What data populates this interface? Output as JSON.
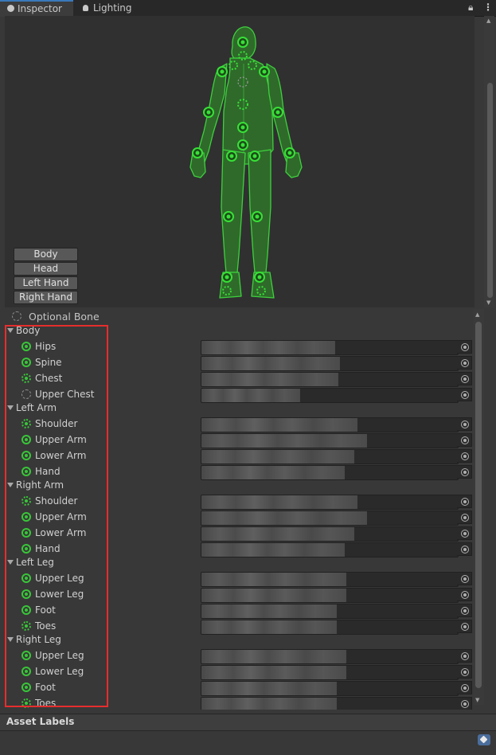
{
  "tabs": [
    {
      "label": "Inspector",
      "icon": "info-icon",
      "active": true
    },
    {
      "label": "Lighting",
      "icon": "bulb-icon",
      "active": false
    }
  ],
  "tab_controls": {
    "lock_icon": "lock-icon",
    "menu_icon": "kebab-menu-icon"
  },
  "avatar_buttons": [
    "Body",
    "Head",
    "Left Hand",
    "Right Hand"
  ],
  "optional_bone_label": "Optional Bone",
  "groups": [
    {
      "label": "Body",
      "bones": [
        {
          "name": "Hips",
          "style": "solid"
        },
        {
          "name": "Spine",
          "style": "solid"
        },
        {
          "name": "Chest",
          "style": "dot"
        },
        {
          "name": "Upper Chest",
          "style": "dash"
        }
      ]
    },
    {
      "label": "Left Arm",
      "bones": [
        {
          "name": "Shoulder",
          "style": "dot"
        },
        {
          "name": "Upper Arm",
          "style": "solid"
        },
        {
          "name": "Lower Arm",
          "style": "solid"
        },
        {
          "name": "Hand",
          "style": "solid"
        }
      ]
    },
    {
      "label": "Right Arm",
      "bones": [
        {
          "name": "Shoulder",
          "style": "dot"
        },
        {
          "name": "Upper Arm",
          "style": "solid"
        },
        {
          "name": "Lower Arm",
          "style": "solid"
        },
        {
          "name": "Hand",
          "style": "solid"
        }
      ]
    },
    {
      "label": "Left Leg",
      "bones": [
        {
          "name": "Upper Leg",
          "style": "solid"
        },
        {
          "name": "Lower Leg",
          "style": "solid"
        },
        {
          "name": "Foot",
          "style": "solid"
        },
        {
          "name": "Toes",
          "style": "dot"
        }
      ]
    },
    {
      "label": "Right Leg",
      "bones": [
        {
          "name": "Upper Leg",
          "style": "solid"
        },
        {
          "name": "Lower Leg",
          "style": "solid"
        },
        {
          "name": "Foot",
          "style": "solid"
        },
        {
          "name": "Toes",
          "style": "dot"
        }
      ]
    }
  ],
  "asset_labels_title": "Asset Labels",
  "colors": {
    "bone_green": "#38c738",
    "highlight_red": "#e62e2e",
    "tab_accent": "#3a79bb"
  }
}
